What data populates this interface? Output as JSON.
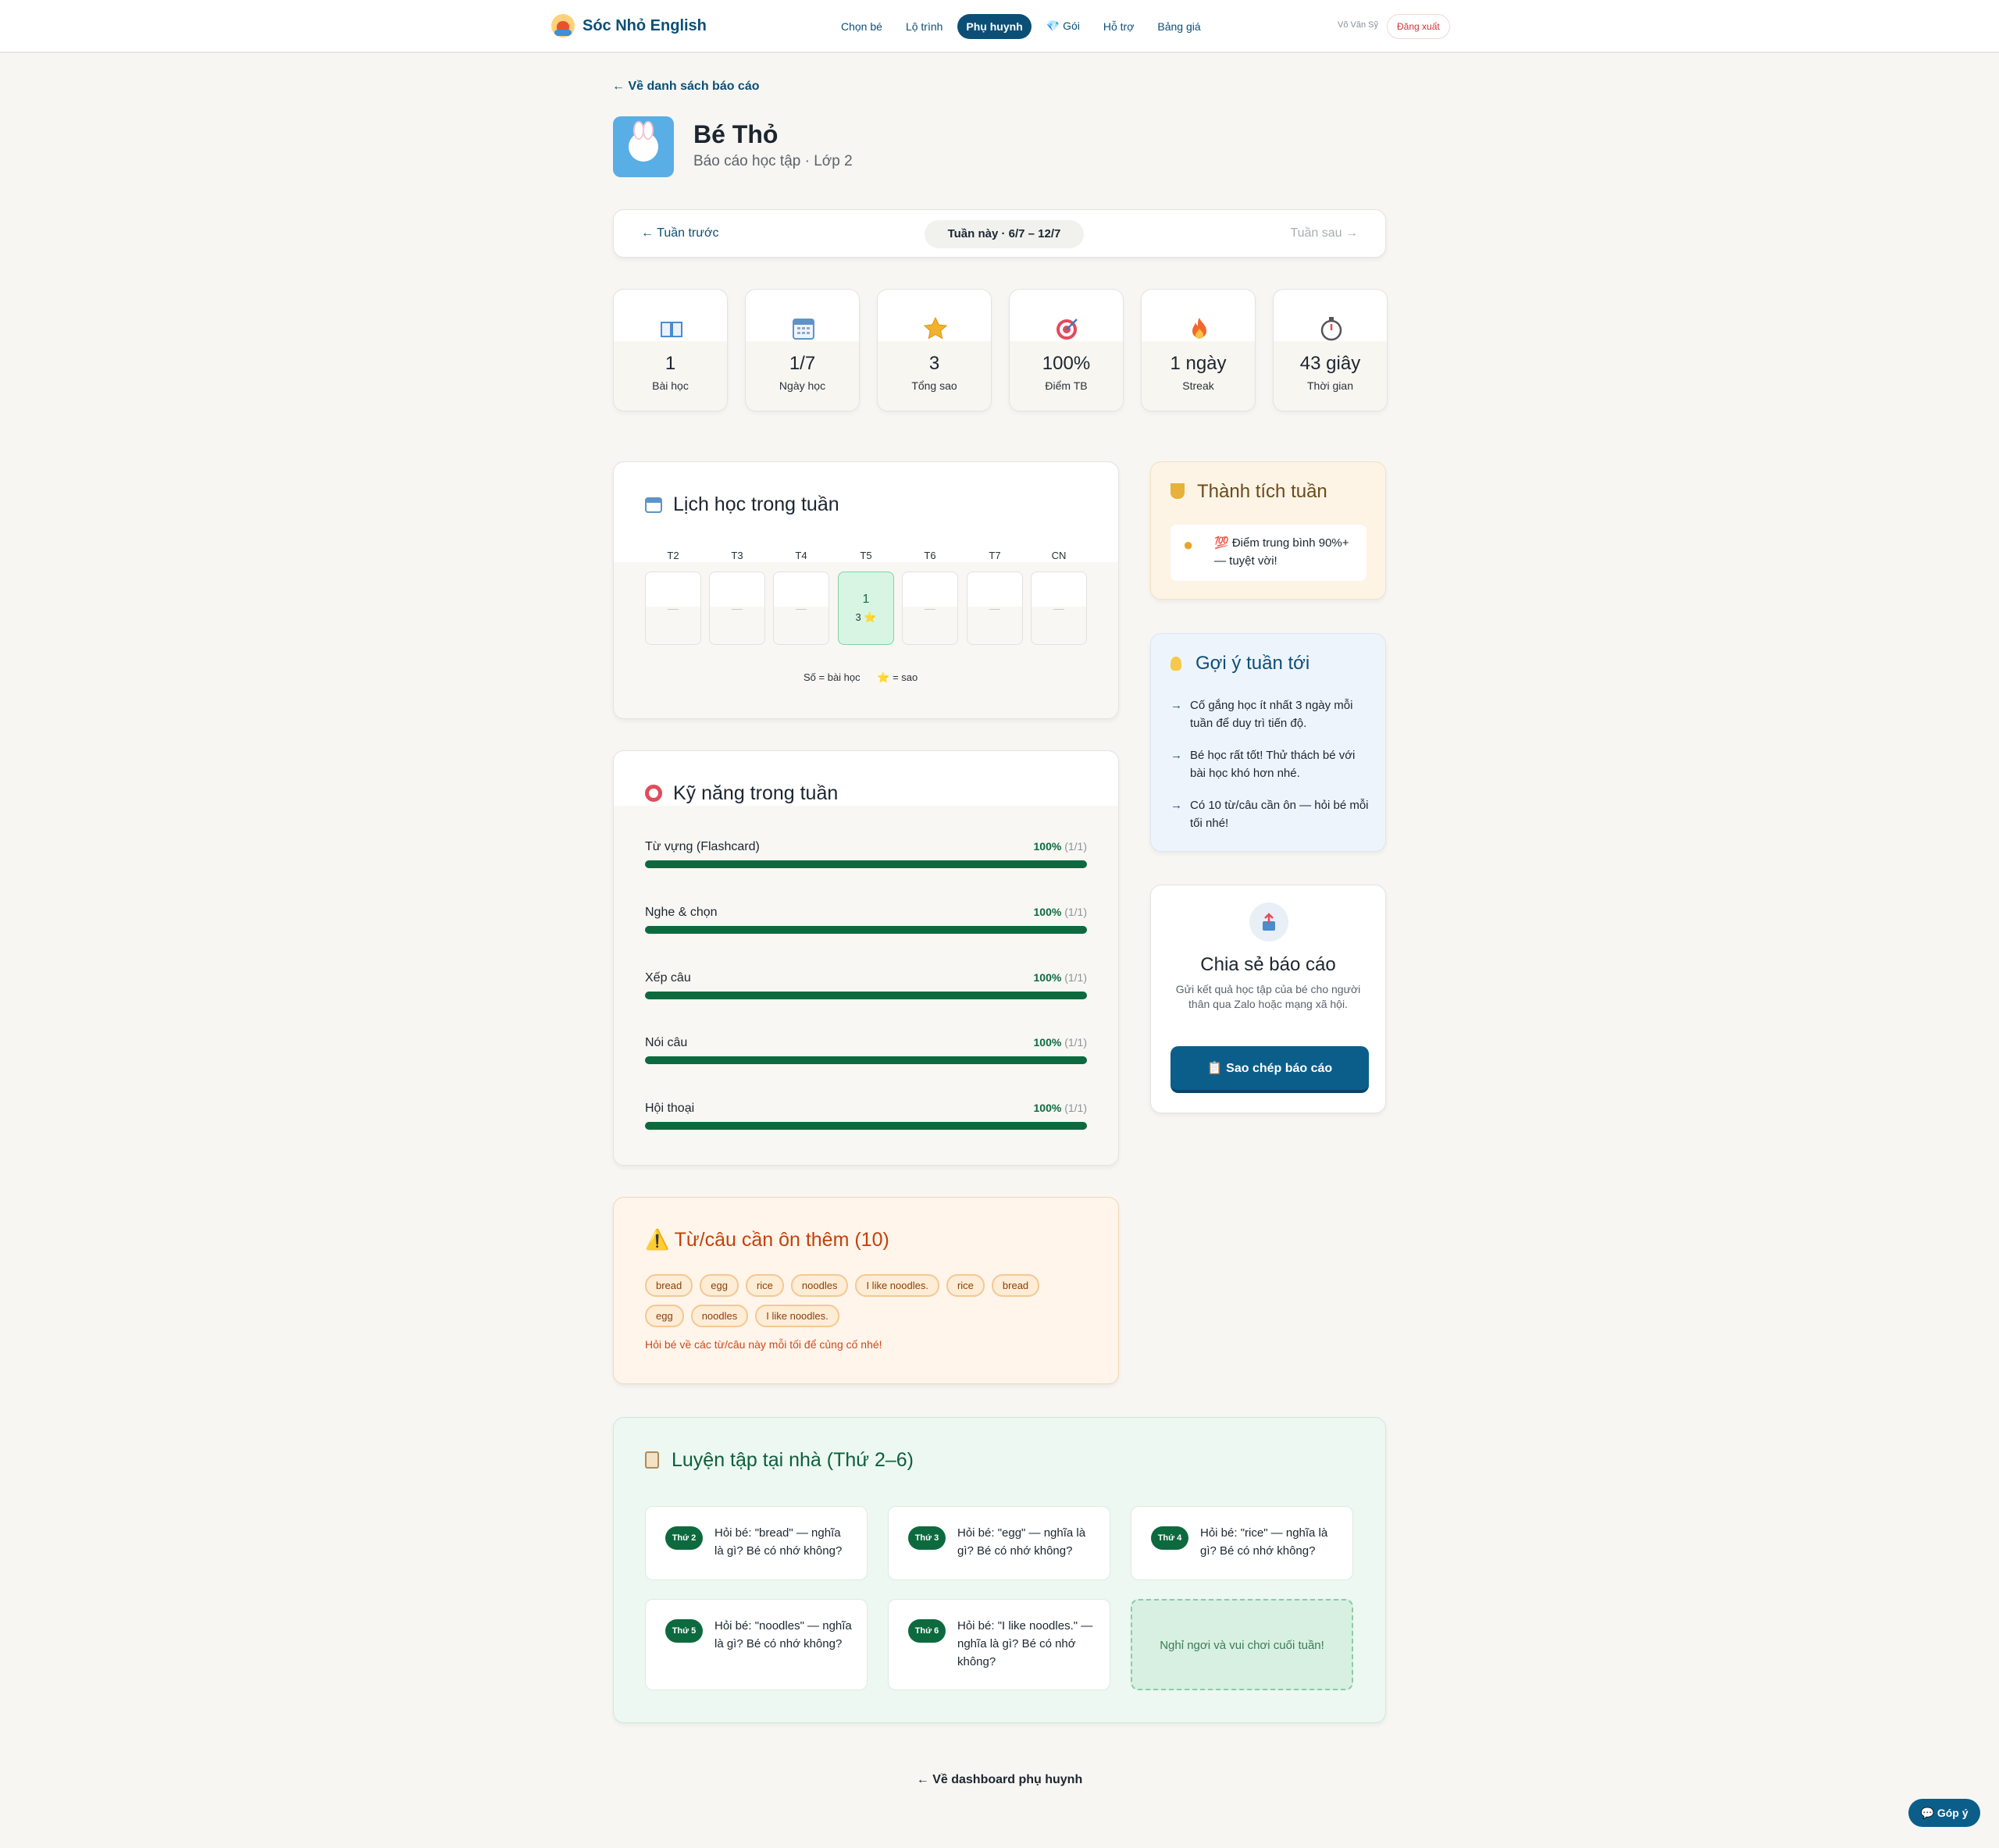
{
  "nav": {
    "brand": "Sóc Nhỏ English",
    "links": [
      "Chọn bé",
      "Lộ trình",
      "Phụ huynh",
      "💎 Gói",
      "Hỗ trợ",
      "Bảng giá"
    ],
    "active_index": 2,
    "user": "Võ Văn Sỹ",
    "logout": "Đăng xuất"
  },
  "back_top": "← Về danh sách báo cáo",
  "profile": {
    "name": "Bé Thỏ",
    "subtitle": "Báo cáo học tập · Lớp 2"
  },
  "week": {
    "prev": "← Tuần trước",
    "current": "Tuần này · 6/7 – 12/7",
    "next": "Tuần sau →"
  },
  "stats": [
    {
      "icon": "book-icon",
      "value": "1",
      "label": "Bài học"
    },
    {
      "icon": "calendar-icon",
      "value": "1/7",
      "label": "Ngày học"
    },
    {
      "icon": "star-icon",
      "value": "3",
      "label": "Tổng sao"
    },
    {
      "icon": "target-icon",
      "value": "100%",
      "label": "Điểm TB"
    },
    {
      "icon": "fire-icon",
      "value": "1 ngày",
      "label": "Streak"
    },
    {
      "icon": "stopwatch-icon",
      "value": "43 giây",
      "label": "Thời gian"
    }
  ],
  "schedule": {
    "title": "Lịch học trong tuần",
    "days": [
      {
        "label": "T2",
        "value": "—",
        "active": false
      },
      {
        "label": "T3",
        "value": "—",
        "active": false
      },
      {
        "label": "T4",
        "value": "—",
        "active": false
      },
      {
        "label": "T5",
        "value": "1",
        "stars": "3 ⭐",
        "active": true
      },
      {
        "label": "T6",
        "value": "—",
        "active": false
      },
      {
        "label": "T7",
        "value": "—",
        "active": false
      },
      {
        "label": "CN",
        "value": "—",
        "active": false
      }
    ],
    "legend": "Số = bài học      ⭐ = sao"
  },
  "skills": {
    "title": "Kỹ năng trong tuần",
    "items": [
      {
        "name": "Từ vựng (Flashcard)",
        "percent": "100%",
        "count": "(1/1)",
        "fraction": 1.0
      },
      {
        "name": "Nghe & chọn",
        "percent": "100%",
        "count": "(1/1)",
        "fraction": 1.0
      },
      {
        "name": "Xếp câu",
        "percent": "100%",
        "count": "(1/1)",
        "fraction": 1.0
      },
      {
        "name": "Nói câu",
        "percent": "100%",
        "count": "(1/1)",
        "fraction": 1.0
      },
      {
        "name": "Hội thoại",
        "percent": "100%",
        "count": "(1/1)",
        "fraction": 1.0
      }
    ]
  },
  "review": {
    "title": "⚠️ Từ/câu cần ôn thêm (10)",
    "chips": [
      "bread",
      "egg",
      "rice",
      "noodles",
      "I like noodles.",
      "rice",
      "bread",
      "egg",
      "noodles",
      "I like noodles."
    ],
    "hint": "Hỏi bé về các từ/câu này mỗi tối để củng cố nhé!"
  },
  "achievements": {
    "title": "Thành tích tuần",
    "item": "💯 Điểm trung bình 90%+ — tuyệt vời!"
  },
  "suggestions": {
    "title": "Gợi ý tuần tới",
    "items": [
      "Cố gắng học ít nhất 3 ngày mỗi tuần để duy trì tiến độ.",
      "Bé học rất tốt! Thử thách bé với bài học khó hơn nhé.",
      "Có 10 từ/câu cần ôn — hỏi bé mỗi tối nhé!"
    ]
  },
  "share": {
    "title": "Chia sẻ báo cáo",
    "desc": "Gửi kết quả học tập của bé cho người thân qua Zalo hoặc mạng xã hội.",
    "button": "📋 Sao chép báo cáo"
  },
  "home_practice": {
    "title": "Luyện tập tại nhà (Thứ 2–6)",
    "items": [
      {
        "day": "Thứ 2",
        "text": "Hỏi bé: \"bread\" — nghĩa là gì? Bé có nhớ không?"
      },
      {
        "day": "Thứ 3",
        "text": "Hỏi bé: \"egg\" — nghĩa là gì? Bé có nhớ không?"
      },
      {
        "day": "Thứ 4",
        "text": "Hỏi bé: \"rice\" — nghĩa là gì? Bé có nhớ không?"
      },
      {
        "day": "Thứ 5",
        "text": "Hỏi bé: \"noodles\" — nghĩa là gì? Bé có nhớ không?"
      },
      {
        "day": "Thứ 6",
        "text": "Hỏi bé: \"I like noodles.\" — nghĩa là gì? Bé có nhớ không?"
      }
    ],
    "weekend": "Nghỉ ngơi và vui chơi cuối tuần!"
  },
  "back_bottom": "← Về dashboard phụ huynh",
  "feedback": "💬 Góp ý"
}
